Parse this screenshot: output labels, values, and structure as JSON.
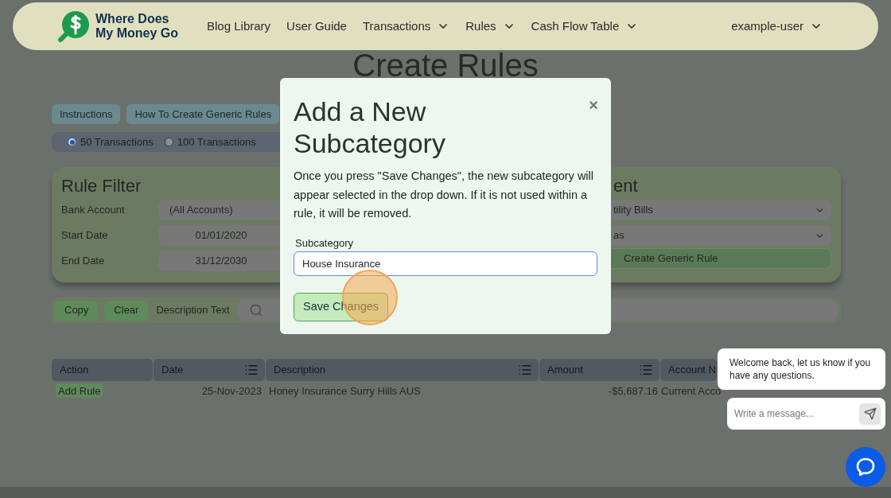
{
  "nav": {
    "logo_line1": "Where Does",
    "logo_line2": "My Money Go",
    "items": [
      {
        "label": "Blog Library",
        "dropdown": false
      },
      {
        "label": "User Guide",
        "dropdown": false
      },
      {
        "label": "Transactions",
        "dropdown": true
      },
      {
        "label": "Rules",
        "dropdown": true
      },
      {
        "label": "Cash Flow Table",
        "dropdown": true
      }
    ],
    "user": "example-user"
  },
  "page_title": "Create Rules",
  "help_buttons": [
    "Instructions",
    "How To Create Generic Rules"
  ],
  "row_limits": [
    {
      "label": "50 Transactions",
      "selected": true
    },
    {
      "label": "100 Transactions",
      "selected": false
    }
  ],
  "rule_filter": {
    "title": "Rule Filter",
    "fields": [
      {
        "label": "Bank Account",
        "value": "(All Accounts)",
        "kind": "select"
      },
      {
        "label": "Start Date",
        "value": "01/01/2020",
        "kind": "date"
      },
      {
        "label": "End Date",
        "value": "31/12/2030",
        "kind": "date"
      }
    ]
  },
  "rule_assignment": {
    "title": "ent",
    "selects": [
      "tility Bills",
      "as"
    ],
    "button": "Create Generic Rule"
  },
  "search_bar": {
    "buttons": [
      "Copy",
      "Clear"
    ],
    "label": "Description Text"
  },
  "table": {
    "columns": [
      {
        "label": "Action",
        "sortable": false
      },
      {
        "label": "Date",
        "sortable": true
      },
      {
        "label": "Description",
        "sortable": true
      },
      {
        "label": "Amount",
        "sortable": true
      },
      {
        "label": "Account N"
      }
    ],
    "rows": [
      {
        "action": "Add Rule",
        "date": "25-Nov-2023",
        "description": "Honey Insurance Surry Hills AUS",
        "amount": "-$5,687.16",
        "account": "Current Acco"
      }
    ]
  },
  "modal": {
    "title": "Add a New Subcategory",
    "close": "×",
    "body": "Once you press \"Save Changes\", the new subcategory will appear selected in the drop down. If it is not used within a rule, it will be removed.",
    "field_label": "Subcategory",
    "field_value": "House Insurance",
    "save_button": "Save Changes"
  },
  "chat": {
    "message": "Welcome back, let us know if you have any questions.",
    "placeholder": "Write a message..."
  }
}
